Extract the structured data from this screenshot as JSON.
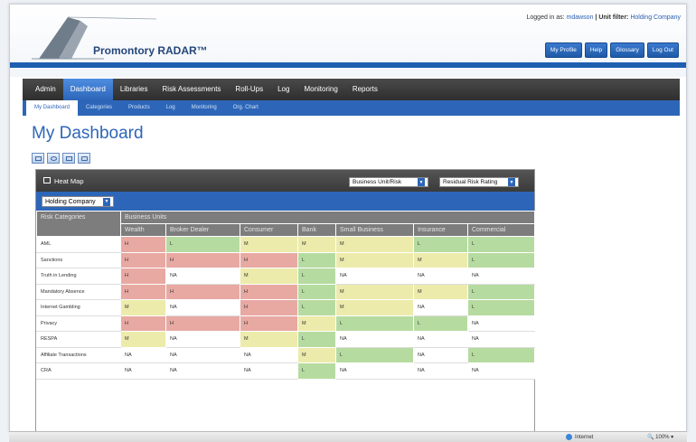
{
  "header": {
    "brand": "Promontory RADAR™",
    "login_prefix": "Logged in as:",
    "user": "mdawson",
    "unit_filter_label": "| Unit filter:",
    "unit_filter_value": "Holding Company",
    "buttons": [
      "My Profile",
      "Help",
      "Glossary",
      "Log Out"
    ]
  },
  "main_nav": {
    "items": [
      "Admin",
      "Dashboard",
      "Libraries",
      "Risk Assessments",
      "Roll-Ups",
      "Log",
      "Monitoring",
      "Reports"
    ],
    "active": "Dashboard"
  },
  "sub_nav": {
    "items": [
      "My Dashboard",
      "Categories",
      "Products",
      "Log",
      "Monitoring",
      "Org. Chart"
    ],
    "active": "My Dashboard"
  },
  "page_title": "My Dashboard",
  "heat_map": {
    "title": "Heat Map",
    "view_select": "Business Unit/Risk",
    "rating_select": "Residual Risk Rating",
    "unit_select": "Holding Company",
    "risk_header": "Risk Categories",
    "units_header": "Business Units",
    "columns": [
      "Wealth",
      "Broker Dealer",
      "Consumer",
      "Bank",
      "Small Business",
      "Insurance",
      "Commercial"
    ],
    "rows": [
      {
        "category": "AML",
        "values": [
          "H",
          "L",
          "M",
          "M",
          "M",
          "L",
          "L"
        ]
      },
      {
        "category": "Sanctions",
        "values": [
          "H",
          "H",
          "H",
          "L",
          "M",
          "M",
          "L"
        ]
      },
      {
        "category": "Truth in Lending",
        "values": [
          "H",
          "NA",
          "M",
          "L",
          "NA",
          "NA",
          "NA"
        ]
      },
      {
        "category": "Mandatory Absence",
        "values": [
          "H",
          "H",
          "H",
          "L",
          "M",
          "M",
          "L"
        ]
      },
      {
        "category": "Internet Gambling",
        "values": [
          "M",
          "NA",
          "H",
          "L",
          "M",
          "NA",
          "L"
        ]
      },
      {
        "category": "Privacy",
        "values": [
          "H",
          "H",
          "H",
          "M",
          "L",
          "L",
          "NA"
        ]
      },
      {
        "category": "RESPA",
        "values": [
          "M",
          "NA",
          "M",
          "L",
          "NA",
          "NA",
          "NA"
        ]
      },
      {
        "category": "Affiliate Transactions",
        "values": [
          "NA",
          "NA",
          "NA",
          "M",
          "L",
          "NA",
          "L"
        ]
      },
      {
        "category": "CRA",
        "values": [
          "NA",
          "NA",
          "NA",
          "L",
          "NA",
          "NA",
          "NA"
        ]
      }
    ]
  },
  "status_bar": {
    "zone": "Internet",
    "zoom": "100%"
  },
  "colors": {
    "brand_blue": "#2d66b8",
    "high": "#e8a9a3",
    "medium": "#ecebab",
    "low": "#b6dba0"
  }
}
